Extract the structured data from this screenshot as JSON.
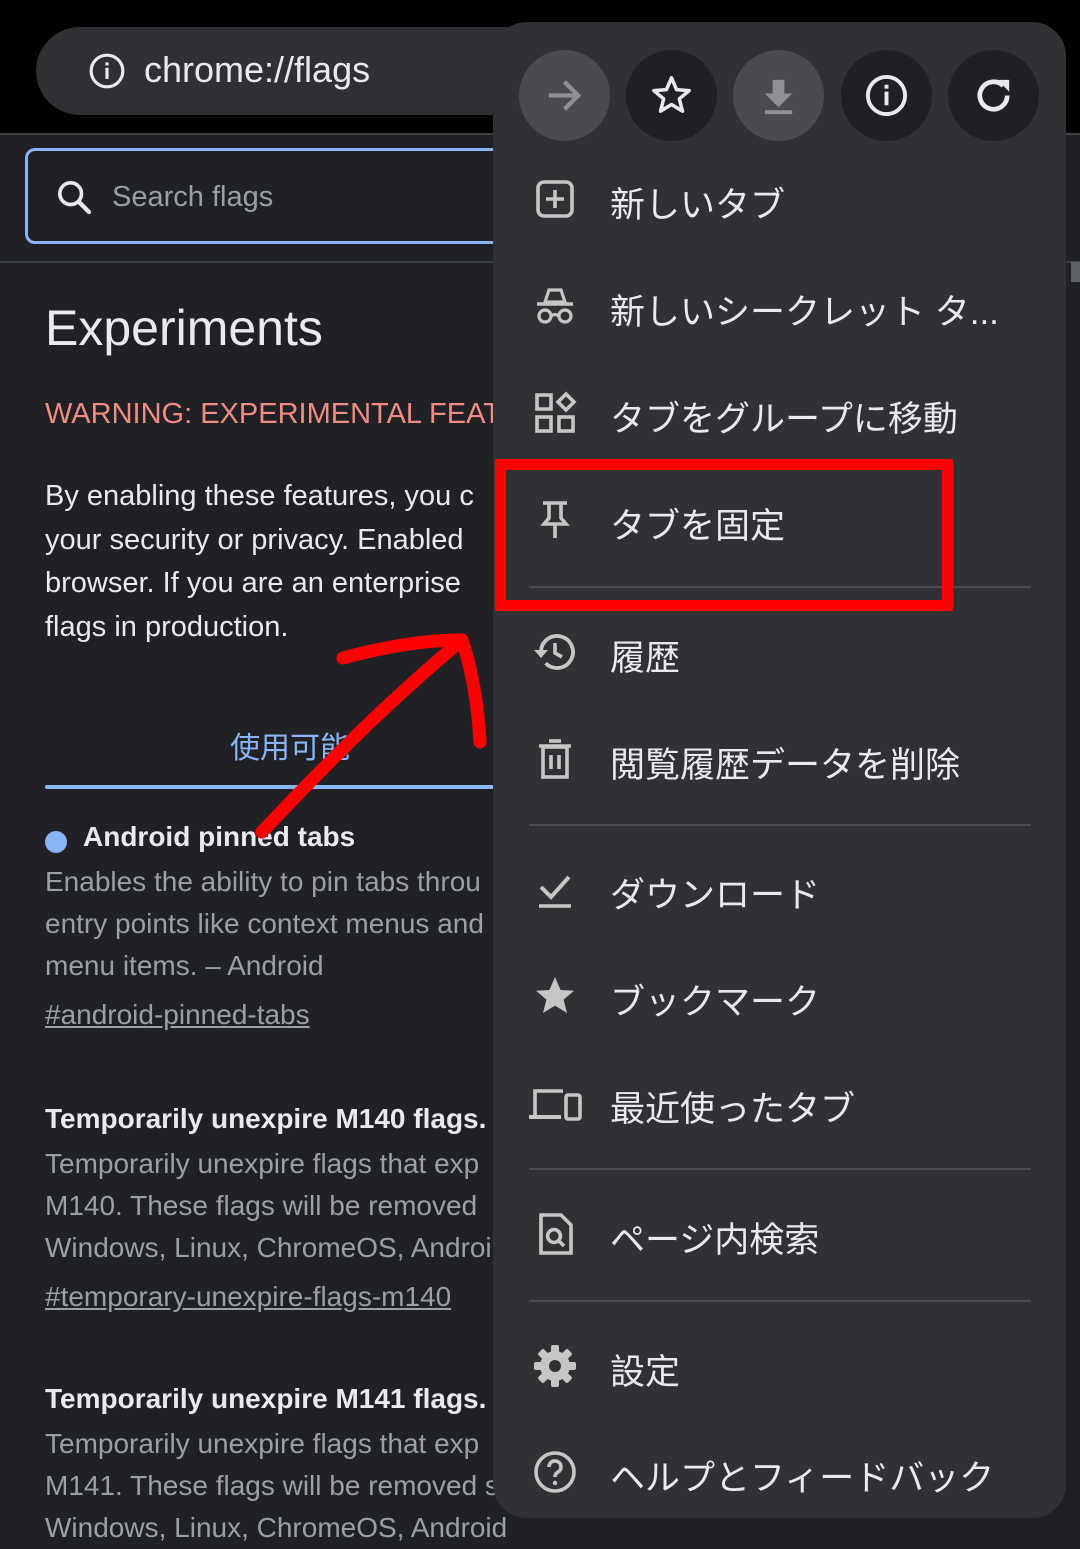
{
  "address_bar": {
    "url": "chrome://flags"
  },
  "search": {
    "placeholder": "Search flags"
  },
  "page": {
    "title": "Experiments",
    "warning": "WARNING: EXPERIMENTAL FEAT",
    "description_lines": [
      "By enabling these features, you c",
      "your security or privacy. Enabled",
      "browser. If you are an enterprise",
      "flags in production."
    ],
    "tab_available": "使用可能"
  },
  "flags": [
    {
      "title": "Android pinned tabs",
      "description_lines": [
        "Enables the ability to pin tabs throu",
        "entry points like context menus and",
        "menu items. – Android"
      ],
      "link": "#android-pinned-tabs"
    },
    {
      "title": "Temporarily unexpire M140 flags.",
      "description_lines": [
        "Temporarily unexpire flags that exp",
        "M140. These flags will be removed",
        "Windows, Linux, ChromeOS, Androi"
      ],
      "link": "#temporary-unexpire-flags-m140"
    },
    {
      "title": "Temporarily unexpire M141 flags.",
      "description_lines": [
        "Temporarily unexpire flags that exp",
        "M141. These flags will be removed s",
        "Windows, Linux, ChromeOS, Android"
      ]
    }
  ],
  "menu": {
    "quick_actions": [
      {
        "icon": "forward-arrow-icon",
        "enabled": false
      },
      {
        "icon": "star-outline-icon",
        "enabled": true
      },
      {
        "icon": "download-icon",
        "enabled": false
      },
      {
        "icon": "info-icon",
        "enabled": true
      },
      {
        "icon": "reload-icon",
        "enabled": true
      }
    ],
    "items": [
      {
        "label": "新しいタブ",
        "icon": "new-tab-icon"
      },
      {
        "label": "新しいシークレット タ...",
        "icon": "incognito-icon"
      },
      {
        "label": "タブをグループに移動",
        "icon": "tab-group-icon"
      },
      {
        "label": "タブを固定",
        "icon": "pin-icon"
      },
      {
        "label": "履歴",
        "icon": "history-icon"
      },
      {
        "label": "閲覧履歴データを削除",
        "icon": "trash-icon"
      },
      {
        "label": "ダウンロード",
        "icon": "download-done-icon"
      },
      {
        "label": "ブックマーク",
        "icon": "bookmark-star-icon"
      },
      {
        "label": "最近使ったタブ",
        "icon": "devices-icon"
      },
      {
        "label": "ページ内検索",
        "icon": "find-in-page-icon"
      },
      {
        "label": "設定",
        "icon": "gear-icon"
      },
      {
        "label": "ヘルプとフィードバック",
        "icon": "help-icon"
      }
    ]
  },
  "annotation": {
    "color": "#ff0000",
    "highlighted_item": "タブを固定"
  },
  "colors": {
    "background": "#202124",
    "menu_bg": "#303134",
    "accent": "#8ab4f8",
    "warning": "#f28b82"
  }
}
